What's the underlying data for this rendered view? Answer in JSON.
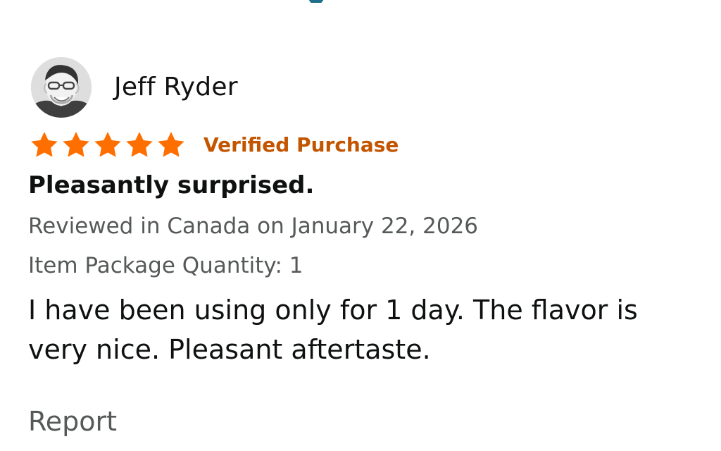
{
  "review": {
    "reviewer_name": "Jeff Ryder",
    "rating": 5,
    "max_rating": 5,
    "star_color": "#ff6f00",
    "verified_label": "Verified Purchase",
    "verified_color": "#c45500",
    "title": "Pleasantly surprised.",
    "reviewed_in": "Reviewed in Canada on January 22, 2026",
    "item_package_quantity": "Item Package Quantity: 1",
    "body": "I have been using only for 1 day. The flavor is very nice. Pleasant aftertaste.",
    "report_label": "Report"
  }
}
